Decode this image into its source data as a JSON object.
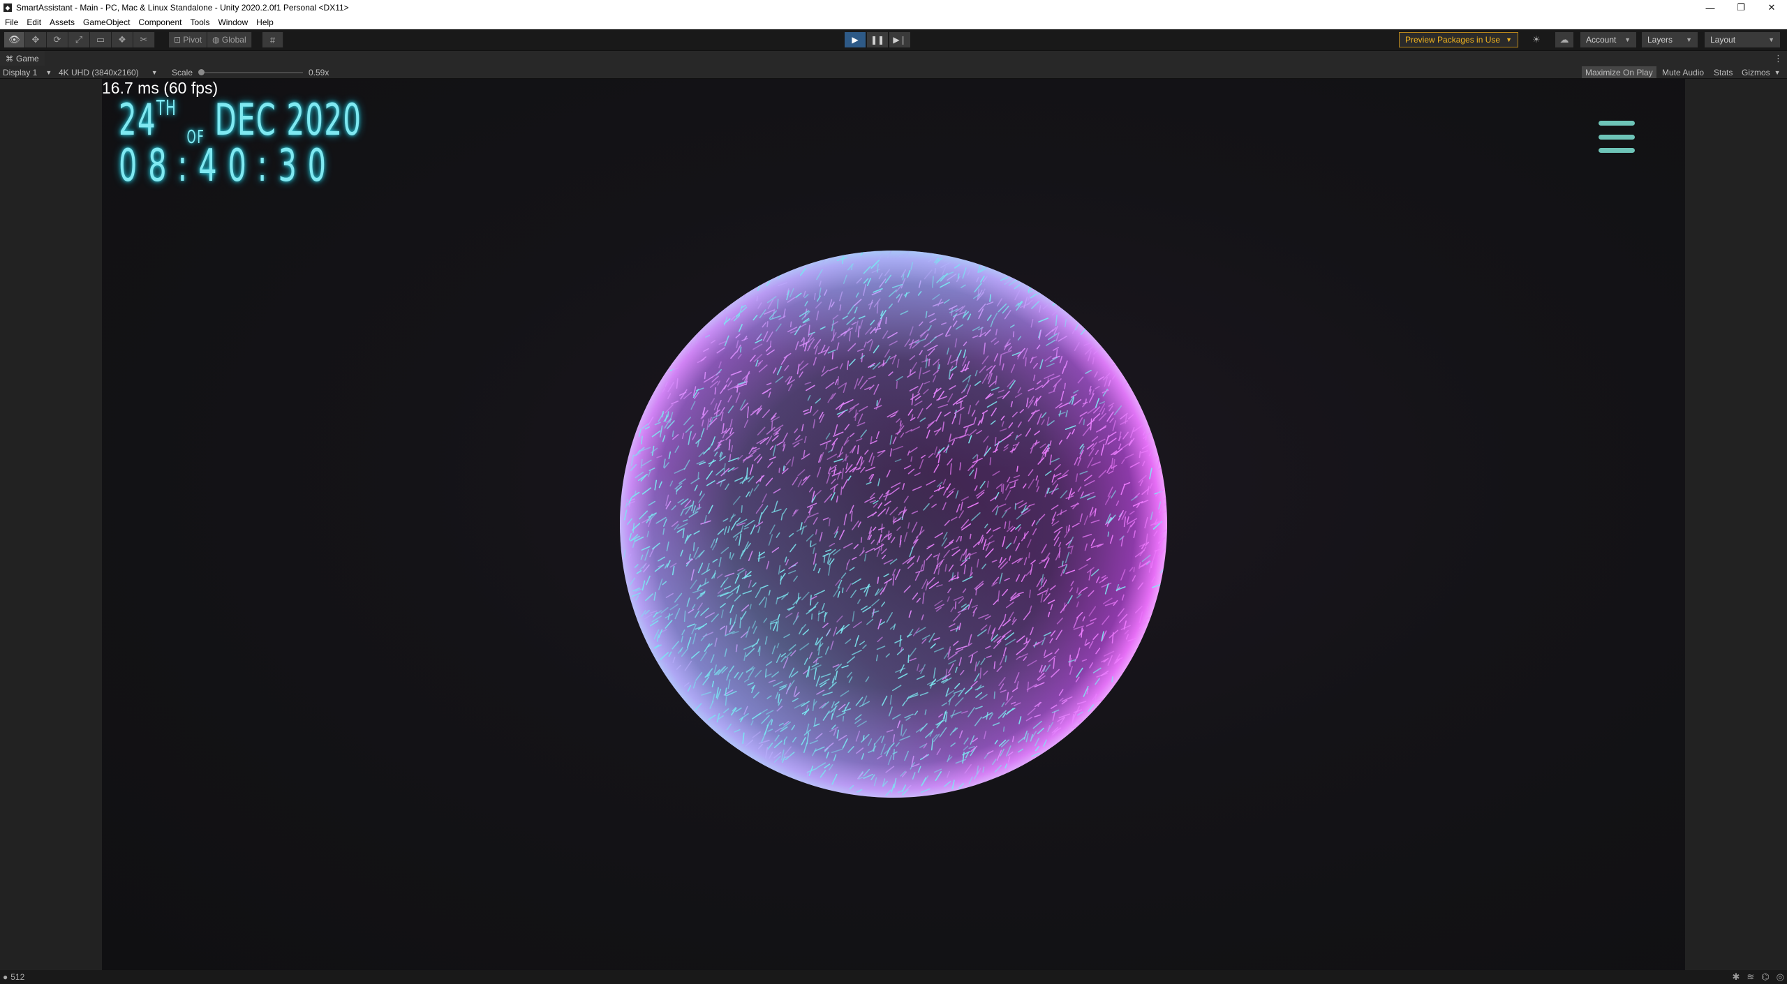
{
  "window": {
    "title": "SmartAssistant - Main - PC, Mac & Linux Standalone - Unity 2020.2.0f1 Personal <DX11>",
    "icons": [
      "unity-logo-icon",
      "minimize-icon",
      "restore-icon",
      "close-icon"
    ]
  },
  "menu": {
    "items": [
      "File",
      "Edit",
      "Assets",
      "GameObject",
      "Component",
      "Tools",
      "Window",
      "Help"
    ]
  },
  "toolbar": {
    "tools": [
      "view-tool-icon",
      "move-tool-icon",
      "rotate-tool-icon",
      "scale-tool-icon",
      "rect-tool-icon",
      "transform-tool-icon",
      "custom-tool-icon"
    ],
    "pivot_label": "Pivot",
    "global_label": "Global",
    "grid_snap_icon": "grid-snap-icon",
    "play_icons": [
      "play-icon",
      "pause-icon",
      "step-icon"
    ],
    "preview_packages_label": "Preview Packages in Use",
    "account_label": "Account",
    "layers_label": "Layers",
    "layout_label": "Layout",
    "accent_color": "#f3b51f",
    "play_active_color": "#2e5a87"
  },
  "game_tab": {
    "label": "Game"
  },
  "game_toolbar": {
    "display_label": "Display 1",
    "resolution_label": "4K UHD (3840x2160)",
    "scale_label": "Scale",
    "scale_value_label": "0.59x",
    "scale_value": 0.59,
    "maximize_label": "Maximize On Play",
    "mute_label": "Mute Audio",
    "stats_label": "Stats",
    "gizmos_label": "Gizmos"
  },
  "game_view": {
    "fps_text": "16.7 ms (60 fps)",
    "date_day": "24",
    "date_suffix": "TH",
    "date_of": "OF",
    "date_month_year": "DEC 2020",
    "time": "08:40:30",
    "neon_color": "#7fe9f2",
    "menu_icon": "hamburger-menu-icon",
    "orb_colors": [
      "#e45cf0",
      "#7fe9f2"
    ]
  },
  "status": {
    "count_label": "512",
    "icons": [
      "bug-icon",
      "network-icon",
      "debug-icon",
      "collab-icon"
    ]
  }
}
